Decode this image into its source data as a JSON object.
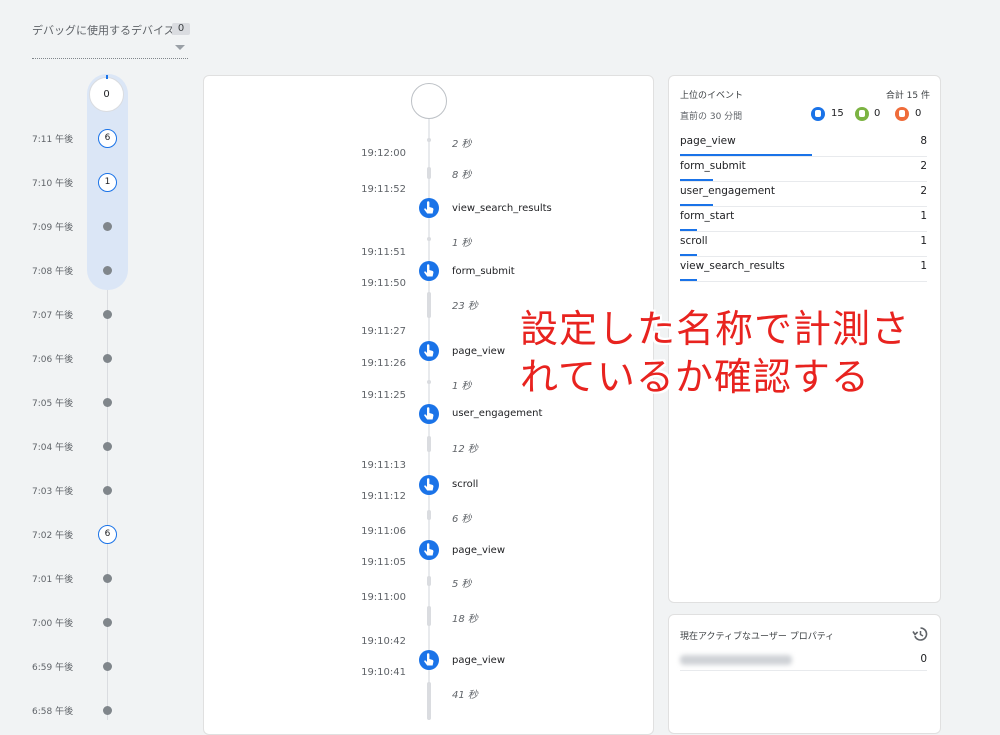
{
  "device_selector": {
    "label": "デバッグに使用するデバイス",
    "count": "0"
  },
  "minutes": {
    "top_count": "0",
    "rows": [
      {
        "time": "7:11 午後",
        "count": "6"
      },
      {
        "time": "7:10 午後",
        "count": "1"
      },
      {
        "time": "7:09 午後",
        "count": null
      },
      {
        "time": "7:08 午後",
        "count": null
      },
      {
        "time": "7:07 午後",
        "count": null
      },
      {
        "time": "7:06 午後",
        "count": null
      },
      {
        "time": "7:05 午後",
        "count": null
      },
      {
        "time": "7:04 午後",
        "count": null
      },
      {
        "time": "7:03 午後",
        "count": null
      },
      {
        "time": "7:02 午後",
        "count": "6"
      },
      {
        "time": "7:01 午後",
        "count": null
      },
      {
        "time": "7:00 午後",
        "count": null
      },
      {
        "time": "6:59 午後",
        "count": null
      },
      {
        "time": "6:58 午後",
        "count": null
      }
    ]
  },
  "stream": {
    "gaps": [
      "2 秒",
      "8 秒",
      "1 秒",
      "23 秒",
      "1 秒",
      "12 秒",
      "6 秒",
      "5 秒",
      "18 秒",
      "41 秒"
    ],
    "times": [
      "19:12:00",
      "19:11:52",
      "19:11:51",
      "19:11:50",
      "19:11:27",
      "19:11:26",
      "19:11:25",
      "19:11:13",
      "19:11:12",
      "19:11:06",
      "19:11:05",
      "19:11:00",
      "19:10:42",
      "19:10:41"
    ],
    "events": [
      "view_search_results",
      "form_submit",
      "page_view",
      "user_engagement",
      "scroll",
      "page_view",
      "page_view"
    ]
  },
  "top_events": {
    "title": "上位のイベント",
    "total": "合計 15 件",
    "range": "直前の 30 分間",
    "counts": {
      "events": "15",
      "conversions": "0",
      "errors": "0"
    },
    "colors": {
      "events": "#1a73e8",
      "conversions": "#7cb342",
      "errors": "#ef6c3a"
    },
    "rows": [
      {
        "name": "page_view",
        "count": "8"
      },
      {
        "name": "form_submit",
        "count": "2"
      },
      {
        "name": "user_engagement",
        "count": "2"
      },
      {
        "name": "form_start",
        "count": "1"
      },
      {
        "name": "scroll",
        "count": "1"
      },
      {
        "name": "view_search_results",
        "count": "1"
      }
    ]
  },
  "user_properties": {
    "title": "現在アクティブなユーザー プロパティ",
    "value": "0",
    "icon": "history-icon"
  },
  "annotation": {
    "line1": "設定した名称で計測さ",
    "line2": "れているか確認する"
  }
}
